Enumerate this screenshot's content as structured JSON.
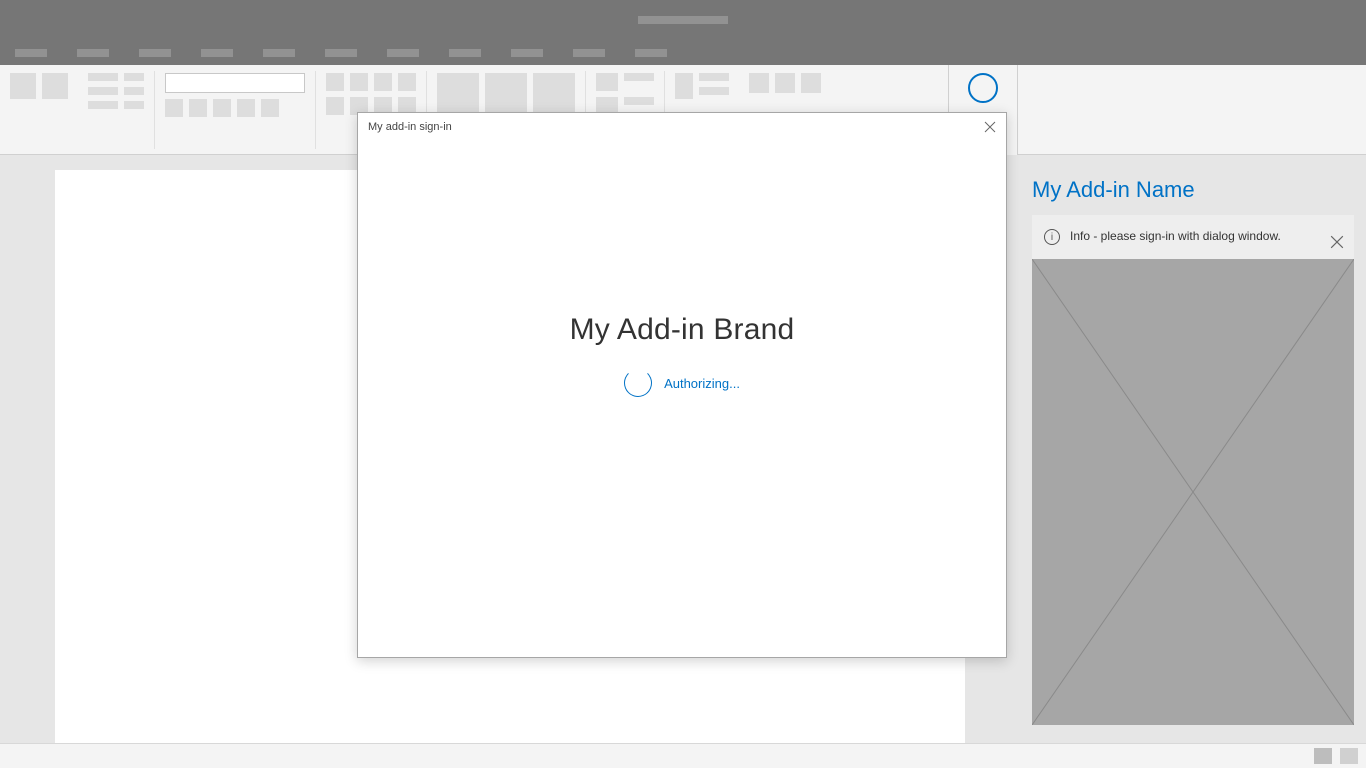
{
  "taskpane": {
    "title": "My Add-in Name",
    "info_message": "Info - please sign-in with dialog window."
  },
  "dialog": {
    "title": "My add-in sign-in",
    "brand": "My Add-in Brand",
    "status_text": "Authorizing..."
  }
}
